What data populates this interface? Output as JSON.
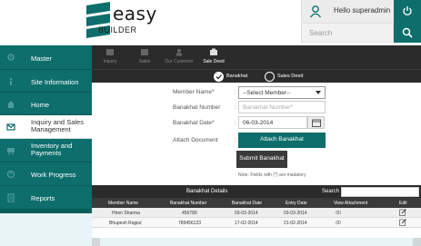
{
  "header": {
    "logo_easy": "easy",
    "logo_builder_prefix": "BUILDER",
    "logo_builder_suffix": "",
    "user_greeting": "Hello superadmin",
    "search_placeholder": "Search"
  },
  "sidebar": {
    "items": [
      {
        "label": "Master",
        "icon": "gear-icon"
      },
      {
        "label": "Site Information",
        "icon": "info-icon"
      },
      {
        "label": "Home",
        "icon": "home-icon"
      },
      {
        "label": "Inquiry and Sales Management",
        "icon": "envelope-icon",
        "active": true
      },
      {
        "label": "Inventory and Payments",
        "icon": "cart-icon"
      },
      {
        "label": "Work Progress",
        "icon": "progress-icon"
      },
      {
        "label": "Reports",
        "icon": "report-icon"
      }
    ]
  },
  "toolbar": {
    "tools": [
      {
        "label": "Inquiry",
        "icon": "inquiry-icon"
      },
      {
        "label": "Sales",
        "icon": "sales-icon"
      },
      {
        "label": "Our Customer",
        "icon": "customer-icon"
      },
      {
        "label": "Sale Deed",
        "icon": "deed-icon",
        "active": true
      }
    ]
  },
  "radio": {
    "banakhat": "Banakhat",
    "sales_deed": "Sales Deed",
    "selected": "banakhat"
  },
  "form": {
    "member_name_label": "Member Name*",
    "member_name_value": "--Select Member--",
    "banakhat_number_label": "Banakhat Number",
    "banakhat_number_placeholder": "Banakhat Number*",
    "banakhat_date_label": "Banakhat Date*",
    "banakhat_date_value": "06-03-2014",
    "attach_label": "Attach Document",
    "attach_button": "Attach Banakhat",
    "colon": ":",
    "submit_button": "Submit Banakhat",
    "note": "Note: Fields with (*) are madatory"
  },
  "details": {
    "title": "Banakhat Details",
    "search_label": "Search",
    "columns": [
      "Member Name",
      "Banakhat Number",
      "Banakhat Date",
      "Entry Date",
      "View Attachment",
      "Edit"
    ],
    "rows": [
      [
        "Hiren Sharma",
        "456789",
        "03-03-2014",
        "03-03-2014"
      ],
      [
        "Bhupesh Rajput",
        "789456123",
        "17-02-2014",
        "21-02-2014"
      ]
    ]
  },
  "colors": {
    "teal": "#0d6e6c",
    "dark": "#2b2b2b"
  }
}
